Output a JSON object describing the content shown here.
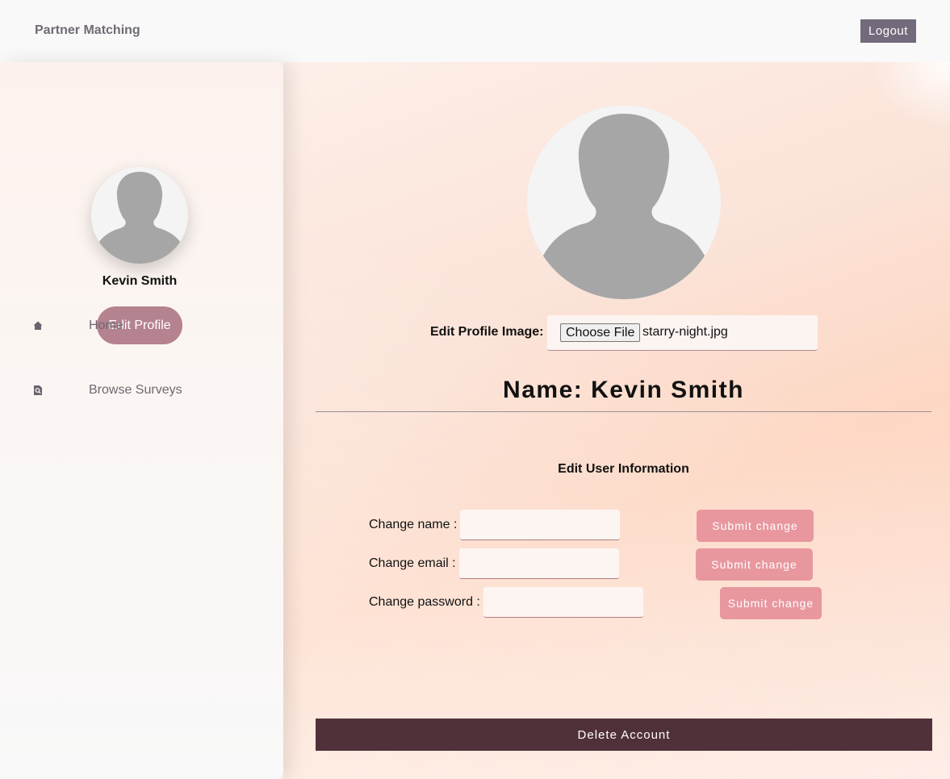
{
  "app": {
    "brand": "Partner Matching",
    "logout_label": "Logout"
  },
  "sidebar": {
    "user_name": "Kevin Smith",
    "edit_profile_label": "Edit Profile",
    "items": [
      {
        "label": "Home",
        "icon": "home-icon"
      },
      {
        "label": "Browse Surveys",
        "icon": "search-document-icon"
      }
    ]
  },
  "profile": {
    "edit_image_label": "Edit Profile Image:",
    "choose_file_label": "Choose File",
    "file_name": "starry-night.jpg",
    "name_heading": "Name: Kevin Smith"
  },
  "edit_info": {
    "title": "Edit User Information",
    "fields": [
      {
        "label": "Change name :",
        "value": "",
        "button": "Submit change"
      },
      {
        "label": "Change email :",
        "value": "",
        "button": "Submit change"
      },
      {
        "label": "Change password :",
        "value": "",
        "button": "Submit change"
      }
    ]
  },
  "delete_account_label": "Delete Account",
  "colors": {
    "logout_bg": "#736a7b",
    "edit_profile_bg": "#b5828f",
    "submit_bg": "#e8979f",
    "delete_bg": "#513139"
  }
}
